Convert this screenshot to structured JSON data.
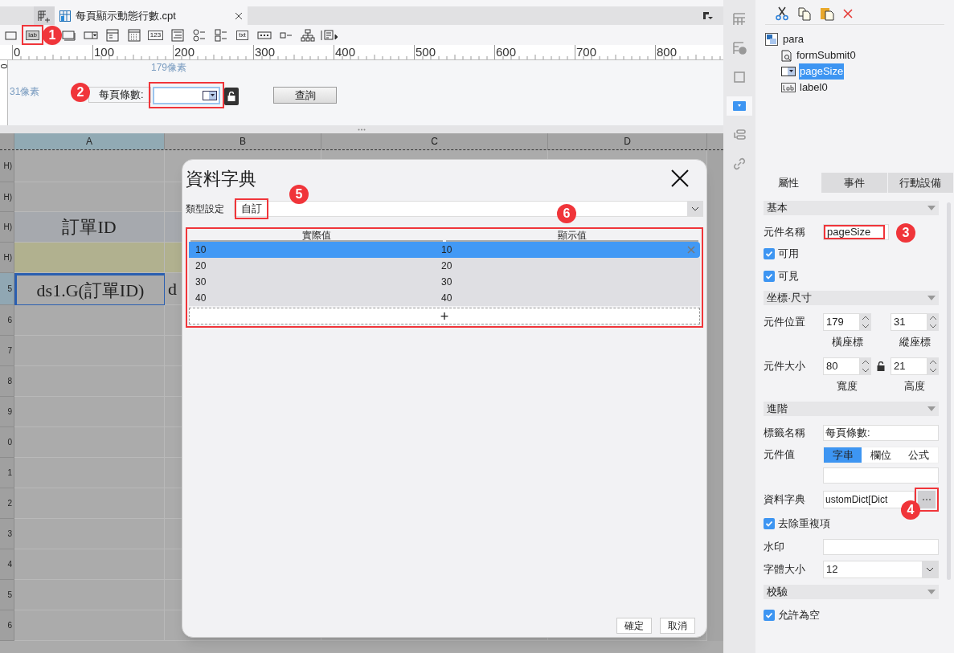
{
  "tab_bar": {
    "tabs": [
      {
        "title": "每頁顯示動態行數.cpt",
        "selected": true
      }
    ]
  },
  "toolbar": [
    {
      "kind": "box",
      "highlighted": false
    },
    {
      "kind": "glyph",
      "glyph": "lab",
      "highlighted": true,
      "badge": "1"
    },
    {
      "kind": "button",
      "highlighted": false
    },
    {
      "kind": "combo",
      "highlighted": false
    },
    {
      "kind": "panel",
      "highlighted": false
    },
    {
      "kind": "calendar",
      "highlighted": false
    },
    {
      "kind": "glyph",
      "glyph": "123",
      "highlighted": false
    },
    {
      "kind": "list",
      "highlighted": false
    },
    {
      "kind": "radio",
      "highlighted": false
    },
    {
      "kind": "checkgroup",
      "highlighted": false
    },
    {
      "kind": "glyph",
      "glyph": "txt",
      "highlighted": false
    },
    {
      "kind": "password",
      "highlighted": false
    },
    {
      "kind": "checkbox",
      "highlighted": false
    },
    {
      "kind": "tree",
      "highlighted": false
    },
    {
      "kind": "more",
      "highlighted": false
    }
  ],
  "ruler": {
    "marks": [
      "0",
      "100",
      "200",
      "300",
      "400",
      "500",
      "600",
      "700",
      "800"
    ],
    "side_mark": "0"
  },
  "canvas": {
    "measure_x": "179像素",
    "measure_y": "31像素",
    "label_widget": "每頁條數:",
    "combo_widget": {
      "highlighted": true,
      "badge": "2"
    },
    "query_button": "查詢"
  },
  "spreadsheet": {
    "columns": [
      {
        "label": "A",
        "selected": true
      },
      {
        "label": "B",
        "selected": false
      },
      {
        "label": "C",
        "selected": false
      },
      {
        "label": "D",
        "selected": false
      }
    ],
    "rows": [
      {
        "label": "H)",
        "kind": "plain",
        "selected": false
      },
      {
        "label": "H)",
        "kind": "plain",
        "selected": false
      },
      {
        "label": "H)",
        "kind": "header",
        "selected": false,
        "cells": [
          {
            "text": "訂單ID",
            "selected": false
          }
        ]
      },
      {
        "label": "H)",
        "kind": "band",
        "selected": false
      },
      {
        "label": "5",
        "kind": "data",
        "selected": true,
        "cells": [
          {
            "text": "ds1.G(訂單ID)",
            "selected": true
          },
          {
            "text": "d",
            "selected": false
          }
        ]
      },
      {
        "label": "6",
        "kind": "plain",
        "selected": false
      },
      {
        "label": "7",
        "kind": "plain",
        "selected": false
      },
      {
        "label": "8",
        "kind": "plain",
        "selected": false
      },
      {
        "label": "9",
        "kind": "plain",
        "selected": false
      },
      {
        "label": "0",
        "kind": "plain",
        "selected": false
      },
      {
        "label": "1",
        "kind": "plain",
        "selected": false
      },
      {
        "label": "2",
        "kind": "plain",
        "selected": false
      },
      {
        "label": "3",
        "kind": "plain",
        "selected": false
      },
      {
        "label": "4",
        "kind": "plain",
        "selected": false
      },
      {
        "label": "5",
        "kind": "plain",
        "selected": false
      },
      {
        "label": "6",
        "kind": "plain",
        "selected": false
      }
    ]
  },
  "dialog": {
    "title": "資料字典",
    "type_label": "類型設定",
    "type_value": "自訂",
    "type_highlighted": true,
    "type_badge": "5",
    "table": {
      "highlighted": true,
      "badge": "6",
      "columns": [
        "實際值",
        "顯示值"
      ],
      "rows": [
        {
          "actual": "10",
          "display": "10",
          "selected": true
        },
        {
          "actual": "20",
          "display": "20",
          "selected": false
        },
        {
          "actual": "30",
          "display": "30",
          "selected": false
        },
        {
          "actual": "40",
          "display": "40",
          "selected": false
        }
      ],
      "add": "+"
    },
    "buttons": [
      "確定",
      "取消"
    ]
  },
  "side_strip": [
    {
      "kind": "grid",
      "selected": false
    },
    {
      "kind": "info",
      "selected": false
    },
    {
      "kind": "frame",
      "selected": false
    },
    {
      "kind": "combo",
      "selected": true
    },
    {
      "kind": "layers",
      "selected": false
    },
    {
      "kind": "link",
      "selected": false
    }
  ],
  "panel": {
    "tree": {
      "label": "para",
      "children": [
        {
          "label": "formSubmit0",
          "kind": "submit",
          "selected": false
        },
        {
          "label": "pageSize",
          "kind": "combo",
          "selected": true
        },
        {
          "label": "label0",
          "kind": "label",
          "selected": false
        }
      ]
    },
    "tabs": [
      {
        "label": "屬性",
        "selected": true
      },
      {
        "label": "事件",
        "selected": false
      },
      {
        "label": "行動設備",
        "selected": false
      }
    ],
    "sections": [
      {
        "title": "基本",
        "rows": [
          {
            "kind": "field",
            "label": "元件名稱",
            "value": "pageSize",
            "highlighted": true,
            "badge": "3"
          },
          {
            "kind": "checkbox",
            "label": "可用",
            "checked": true
          },
          {
            "kind": "checkbox",
            "label": "可見",
            "checked": true
          }
        ]
      },
      {
        "title": "坐標·尺寸",
        "rows": [
          {
            "kind": "pair",
            "label": "元件位置",
            "linked": false,
            "first": {
              "value": "179",
              "caption": "橫座標"
            },
            "second": {
              "value": "31",
              "caption": "縱座標"
            }
          },
          {
            "kind": "pair",
            "label": "元件大小",
            "linked": true,
            "first": {
              "value": "80",
              "caption": "寬度"
            },
            "second": {
              "value": "21",
              "caption": "高度"
            }
          }
        ]
      },
      {
        "title": "進階",
        "rows": [
          {
            "kind": "field",
            "label": "標籤名稱",
            "value": "每頁條數:",
            "highlighted": false
          },
          {
            "kind": "segmented",
            "label": "元件值",
            "options": [
              {
                "label": "字串",
                "selected": true
              },
              {
                "label": "欄位",
                "selected": false
              },
              {
                "label": "公式",
                "selected": false
              }
            ]
          },
          {
            "kind": "dict",
            "label": "資料字典",
            "value": "ustomDict[Dict",
            "highlighted": true,
            "badge": "4"
          },
          {
            "kind": "checkbox",
            "label": "去除重複項",
            "checked": true
          },
          {
            "kind": "field",
            "label": "水印",
            "highlighted": false
          },
          {
            "kind": "select",
            "label": "字體大小",
            "value": "12"
          }
        ]
      },
      {
        "title": "校驗",
        "rows": [
          {
            "kind": "checkbox",
            "label": "允許為空",
            "checked": true
          }
        ]
      }
    ]
  }
}
